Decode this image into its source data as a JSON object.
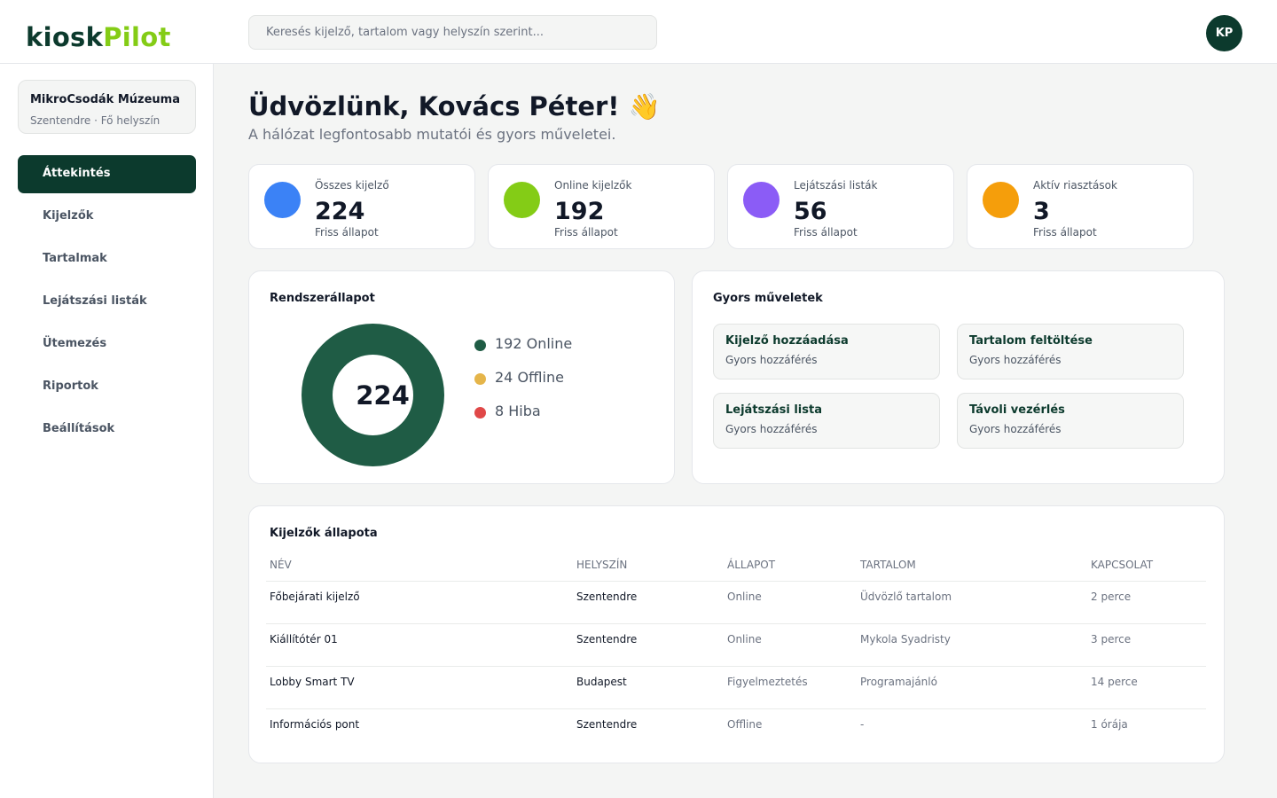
{
  "app": {
    "logo_part1": "kiosk",
    "logo_part2": "Pilot"
  },
  "header": {
    "search_placeholder": "Keresés kijelző, tartalom vagy helyszín szerint...",
    "avatar_initials": "KP"
  },
  "sidebar": {
    "location": {
      "name": "MikroCsodák Múzeuma",
      "subtitle": "Szentendre · Fő helyszín"
    },
    "items": [
      {
        "label": "Áttekintés",
        "active": true
      },
      {
        "label": "Kijelzők",
        "active": false
      },
      {
        "label": "Tartalmak",
        "active": false
      },
      {
        "label": "Lejátszási listák",
        "active": false
      },
      {
        "label": "Ütemezés",
        "active": false
      },
      {
        "label": "Riportok",
        "active": false
      },
      {
        "label": "Beállítások",
        "active": false
      }
    ]
  },
  "main": {
    "title": "Üdvözlünk, Kovács Péter! 👋",
    "subtitle": "A hálózat legfontosabb mutatói és gyors műveletei.",
    "stats": [
      {
        "label": "Összes kijelző",
        "value": "224",
        "footer": "Friss állapot",
        "color": "#3b82f6"
      },
      {
        "label": "Online kijelzők",
        "value": "192",
        "footer": "Friss állapot",
        "color": "#84cc16"
      },
      {
        "label": "Lejátszási listák",
        "value": "56",
        "footer": "Friss állapot",
        "color": "#8b5cf6"
      },
      {
        "label": "Aktív riasztások",
        "value": "3",
        "footer": "Friss állapot",
        "color": "#f59e0b"
      }
    ],
    "system_status": {
      "title": "Rendszerállapot",
      "total": "224",
      "legend": [
        {
          "label": "192 Online",
          "color": "#1f5c45"
        },
        {
          "label": "24 Offline",
          "color": "#e5b54a"
        },
        {
          "label": "8 Hiba",
          "color": "#e04848"
        }
      ]
    },
    "quick_actions": {
      "title": "Gyors műveletek",
      "items": [
        {
          "title": "Kijelző hozzáadása",
          "subtitle": "Gyors hozzáférés"
        },
        {
          "title": "Tartalom feltöltése",
          "subtitle": "Gyors hozzáférés"
        },
        {
          "title": "Lejátszási lista",
          "subtitle": "Gyors hozzáférés"
        },
        {
          "title": "Távoli vezérlés",
          "subtitle": "Gyors hozzáférés"
        }
      ]
    },
    "displays_table": {
      "title": "Kijelzők állapota",
      "columns": [
        "NÉV",
        "HELYSZÍN",
        "ÁLLAPOT",
        "TARTALOM",
        "KAPCSOLAT"
      ],
      "rows": [
        [
          "Főbejárati kijelző",
          "Szentendre",
          "Online",
          "Üdvözlő tartalom",
          "2 perce"
        ],
        [
          "Kiállítótér 01",
          "Szentendre",
          "Online",
          "Mykola Syadristy",
          "3 perce"
        ],
        [
          "Lobby Smart TV",
          "Budapest",
          "Figyelmeztetés",
          "Programajánló",
          "14 perce"
        ],
        [
          "Információs pont",
          "Szentendre",
          "Offline",
          "-",
          "1 órája"
        ]
      ]
    }
  }
}
